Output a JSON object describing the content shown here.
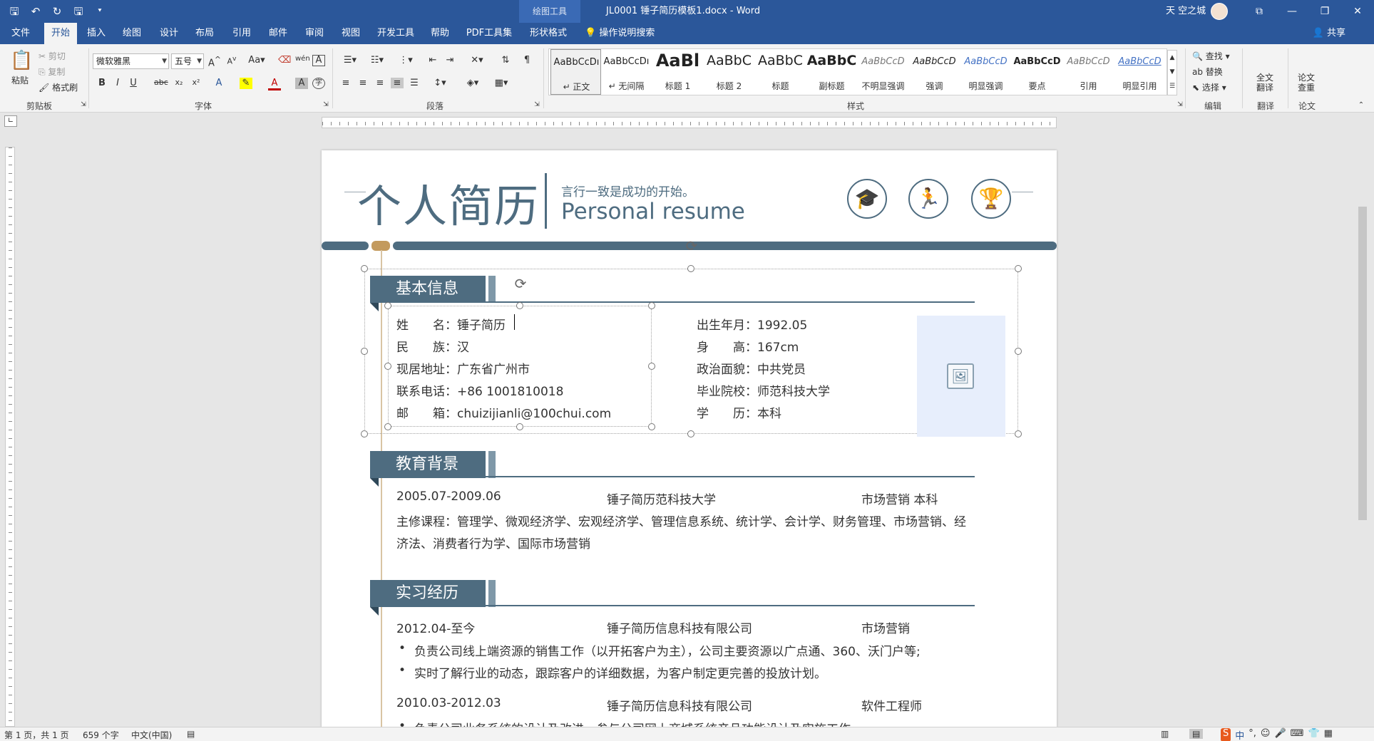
{
  "titlebar": {
    "qat_save": "🖫",
    "qat_undo": "↶",
    "qat_redo": "↻",
    "qat_touch": "🖫",
    "qat_more": "⯆",
    "context_tool": "绘图工具",
    "doc_title": "JL0001 锤子简历模板1.docx - Word",
    "user_name": "天 空之城",
    "btn_ribbon_opts": "⧉",
    "btn_min": "—",
    "btn_max": "❐",
    "btn_close": "✕"
  },
  "tabs": [
    {
      "label": "文件"
    },
    {
      "label": "开始"
    },
    {
      "label": "插入"
    },
    {
      "label": "绘图"
    },
    {
      "label": "设计"
    },
    {
      "label": "布局"
    },
    {
      "label": "引用"
    },
    {
      "label": "邮件"
    },
    {
      "label": "审阅"
    },
    {
      "label": "视图"
    },
    {
      "label": "开发工具"
    },
    {
      "label": "帮助"
    },
    {
      "label": "PDF工具集"
    },
    {
      "label": "形状格式"
    }
  ],
  "tellme": "操作说明搜索",
  "share": "共享",
  "ribbon": {
    "clipboard": {
      "paste": "粘贴",
      "cut": "剪切",
      "copy": "复制",
      "format_painter": "格式刷",
      "label": "剪贴板"
    },
    "font": {
      "family": "微软雅黑",
      "size": "五号",
      "label": "字体"
    },
    "paragraph": {
      "label": "段落"
    },
    "styles": {
      "label": "样式",
      "items": [
        {
          "sample": "AaBbCcDı",
          "name": "↵ 正文"
        },
        {
          "sample": "AaBbCcDı",
          "name": "↵ 无间隔"
        },
        {
          "sample": "AaBl",
          "name": "标题 1"
        },
        {
          "sample": "AaBbC",
          "name": "标题 2"
        },
        {
          "sample": "AaBbC",
          "name": "标题"
        },
        {
          "sample": "AaBbC",
          "name": "副标题"
        },
        {
          "sample": "AaBbCcD",
          "name": "不明显强调"
        },
        {
          "sample": "AaBbCcD",
          "name": "强调"
        },
        {
          "sample": "AaBbCcD",
          "name": "明显强调"
        },
        {
          "sample": "AaBbCcD",
          "name": "要点"
        },
        {
          "sample": "AaBbCcD",
          "name": "引用"
        },
        {
          "sample": "AaBbCcD",
          "name": "明显引用"
        }
      ]
    },
    "editing": {
      "find": "查找",
      "replace": "替换",
      "select": "选择",
      "label": "编辑"
    },
    "translate": {
      "full": "全文\n翻译",
      "label": "翻译"
    },
    "paper": {
      "check": "论文\n查重",
      "label": "论文"
    }
  },
  "resume": {
    "title_cn": "个人简历",
    "motto": "言行一致是成功的开始。",
    "title_en": "Personal resume",
    "section_basic": "基本信息",
    "basic_left": [
      "姓　　名：锤子简历",
      "民　　族：汉",
      "现居地址：广东省广州市",
      "联系电话：+86 1001810018",
      "邮　　箱：chuizijianli@100chui.com"
    ],
    "basic_right": [
      "出生年月：1992.05",
      "身　　高：167cm",
      "政治面貌：中共党员",
      "毕业院校：师范科技大学",
      "学　　历：本科"
    ],
    "section_edu": "教育背景",
    "edu_date": "2005.07-2009.06",
    "edu_school": "锤子简历范科技大学",
    "edu_major": "市场营销  本科",
    "edu_courses_1": "主修课程：管理学、微观经济学、宏观经济学、管理信息系统、统计学、会计学、财务管理、市场营销、经",
    "edu_courses_2": "济法、消费者行为学、国际市场营销",
    "section_intern": "实习经历",
    "job1_date": "2012.04-至今",
    "job1_company": "锤子简历信息科技有限公司",
    "job1_role": "市场营销",
    "job1_b1": "负责公司线上端资源的销售工作（以开拓客户为主），公司主要资源以广点通、360、沃门户等;",
    "job1_b2": "实时了解行业的动态，跟踪客户的详细数据，为客户制定更完善的投放计划。",
    "job2_date": "2010.03-2012.03",
    "job2_company": "锤子简历信息科技有限公司",
    "job2_role": "软件工程师",
    "job2_b1": "负责公司业务系统的设计及改进，参与公司网上商城系统产品功能设计及实施工作;"
  },
  "statusbar": {
    "page": "第 1 页，共 1 页",
    "words": "659 个字",
    "lang": "中文(中国)",
    "ime": "中"
  },
  "colors": {
    "accent": "#2b579a",
    "resume_primary": "#4e6c80",
    "resume_gold": "#c39a5d"
  }
}
